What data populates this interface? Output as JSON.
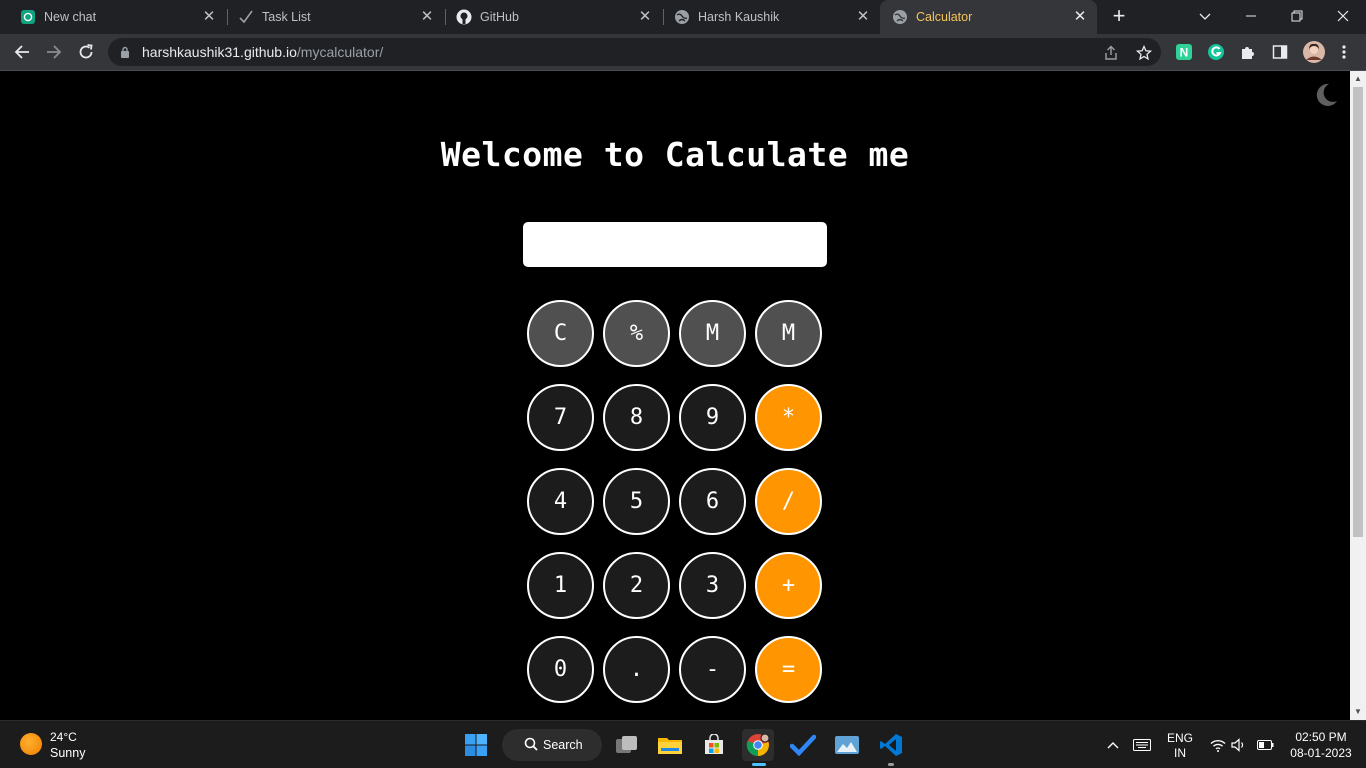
{
  "browser": {
    "tabs": [
      {
        "label": "New chat",
        "icon": "chatgpt-icon"
      },
      {
        "label": "Task List",
        "icon": "checkmark-icon"
      },
      {
        "label": "GitHub",
        "icon": "github-icon"
      },
      {
        "label": "Harsh Kaushik",
        "icon": "globe-icon"
      },
      {
        "label": "Calculator",
        "icon": "globe-icon",
        "active": true
      }
    ],
    "url_host": "harshkaushik31.github.io",
    "url_path": "/mycalculator/"
  },
  "page": {
    "title": "Welcome to Calculate me",
    "display_value": "",
    "keys": [
      [
        "C",
        "%",
        "M",
        "M"
      ],
      [
        "7",
        "8",
        "9",
        "*"
      ],
      [
        "4",
        "5",
        "6",
        "/"
      ],
      [
        "1",
        "2",
        "3",
        "+"
      ],
      [
        "0",
        ".",
        "-",
        "="
      ]
    ],
    "colors": {
      "function_key": "#505050",
      "number_key": "#1c1c1c",
      "operator_key": "#ff9500"
    }
  },
  "taskbar": {
    "weather_temp": "24°C",
    "weather_condition": "Sunny",
    "search_label": "Search",
    "language": "ENG",
    "region": "IN",
    "time": "02:50 PM",
    "date": "08-01-2023"
  }
}
